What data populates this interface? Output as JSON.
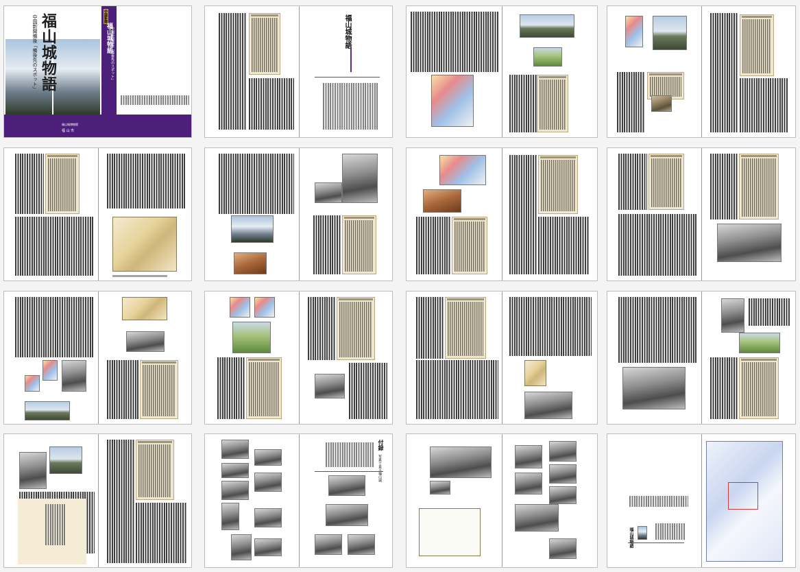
{
  "cover": {
    "title": "福山城物語",
    "subtitle": "中国新聞備後「備後先のスポット」",
    "spine_badge": "中国新聞",
    "spine_title": "福山城物語",
    "spine_subtitle": "中国新聞備後「備後先のスポット」",
    "publisher": "福山城博物館",
    "author": "福 山 市"
  },
  "inner_title": "福山城物語",
  "appendix_title": "付録",
  "appendix_sub": "写真で見る福山城",
  "back_title": "福山城物語",
  "colors": {
    "accent_purple": "#4b1f7a",
    "newsprint": "#efe7d2"
  }
}
